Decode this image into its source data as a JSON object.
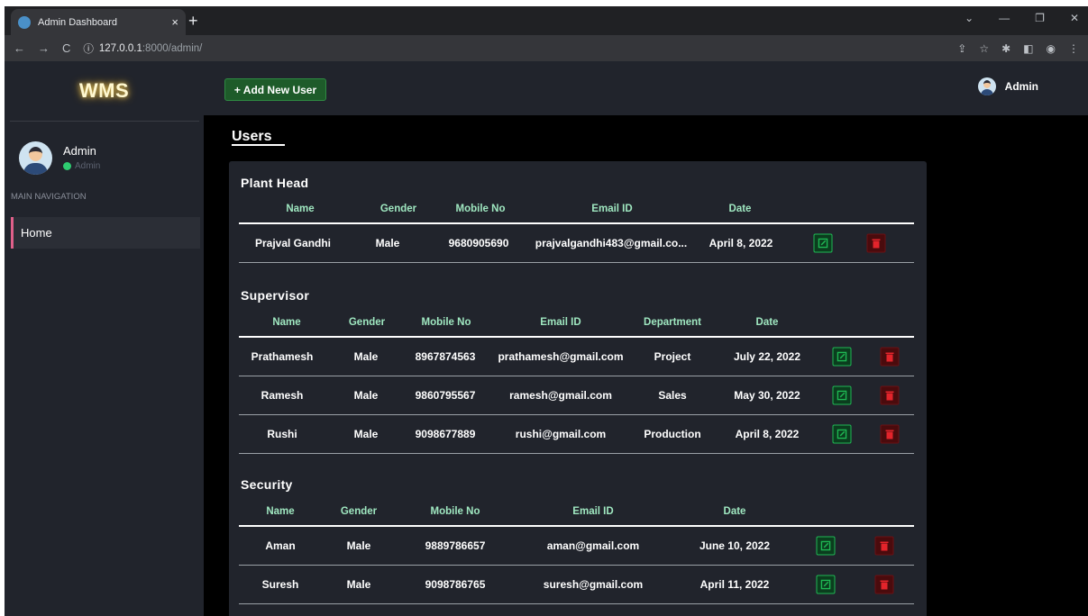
{
  "browser": {
    "tab_title": "Admin Dashboard",
    "tab_close": "×",
    "new_tab": "+",
    "url_host": "127.0.0.1",
    "url_rest": ":8000/admin/"
  },
  "sidebar": {
    "brand": "WMS",
    "user_name": "Admin",
    "user_role": "Admin",
    "nav_heading": "MAIN NAVIGATION",
    "nav_items": [
      "Home"
    ]
  },
  "topbar": {
    "add_button_label": "+ Add New User",
    "user_name": "Admin"
  },
  "page": {
    "title": "Users"
  },
  "sections": {
    "plant_head": {
      "title": "Plant Head",
      "headers": [
        "Name",
        "Gender",
        "Mobile No",
        "Email ID",
        "Date"
      ],
      "rows": [
        [
          "Prajval Gandhi",
          "Male",
          "9680905690",
          "prajvalgandhi483@gmail.co...",
          "April 8, 2022"
        ]
      ]
    },
    "supervisor": {
      "title": "Supervisor",
      "headers": [
        "Name",
        "Gender",
        "Mobile No",
        "Email ID",
        "Department",
        "Date"
      ],
      "rows": [
        [
          "Prathamesh",
          "Male",
          "8967874563",
          "prathamesh@gmail.com",
          "Project",
          "July 22, 2022"
        ],
        [
          "Ramesh",
          "Male",
          "9860795567",
          "ramesh@gmail.com",
          "Sales",
          "May 30, 2022"
        ],
        [
          "Rushi",
          "Male",
          "9098677889",
          "rushi@gmail.com",
          "Production",
          "April 8, 2022"
        ]
      ]
    },
    "security": {
      "title": "Security",
      "headers": [
        "Name",
        "Gender",
        "Mobile No",
        "Email ID",
        "Date"
      ],
      "rows": [
        [
          "Aman",
          "Male",
          "9889786657",
          "aman@gmail.com",
          "June 10, 2022"
        ],
        [
          "Suresh",
          "Male",
          "9098786765",
          "suresh@gmail.com",
          "April 11, 2022"
        ]
      ]
    }
  },
  "colors": {
    "edit_accent": "#1fb854",
    "delete_accent": "#e3242b",
    "header_text": "#9fe7c0",
    "nav_active_border": "#e0608a"
  }
}
